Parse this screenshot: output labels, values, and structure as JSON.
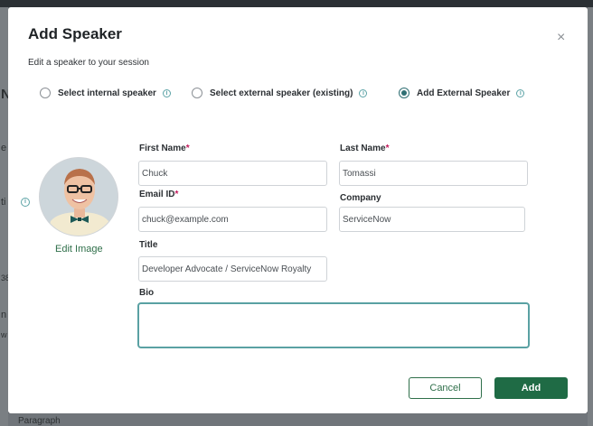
{
  "background": {
    "glyph_n": "N",
    "glyph_e": "e",
    "glyph_ti": "ti",
    "glyph_38": "38",
    "glyph_n2": "n",
    "glyph_w": "w",
    "paragraph": "Paragraph"
  },
  "modal": {
    "title": "Add Speaker",
    "subtitle": "Edit a speaker to your session",
    "close_icon": "×"
  },
  "options": [
    {
      "label": "Select internal speaker",
      "checked": false
    },
    {
      "label": "Select external speaker (existing)",
      "checked": false
    },
    {
      "label": "Add External Speaker",
      "checked": true
    }
  ],
  "info_glyph": "i",
  "avatar": {
    "edit_label": "Edit Image"
  },
  "form": {
    "first_name": {
      "label": "First Name",
      "value": "Chuck"
    },
    "last_name": {
      "label": "Last Name",
      "value": "Tomassi"
    },
    "email": {
      "label": "Email ID",
      "value": "chuck@example.com"
    },
    "company": {
      "label": "Company",
      "value": "ServiceNow"
    },
    "title": {
      "label": "Title",
      "value": "Developer Advocate / ServiceNow Royalty"
    },
    "bio": {
      "label": "Bio",
      "value": ""
    },
    "required_mark": "*"
  },
  "buttons": {
    "cancel": "Cancel",
    "add": "Add"
  },
  "colors": {
    "primary": "#1f6b45",
    "accent": "#2f6f73",
    "required": "#c2185b"
  }
}
